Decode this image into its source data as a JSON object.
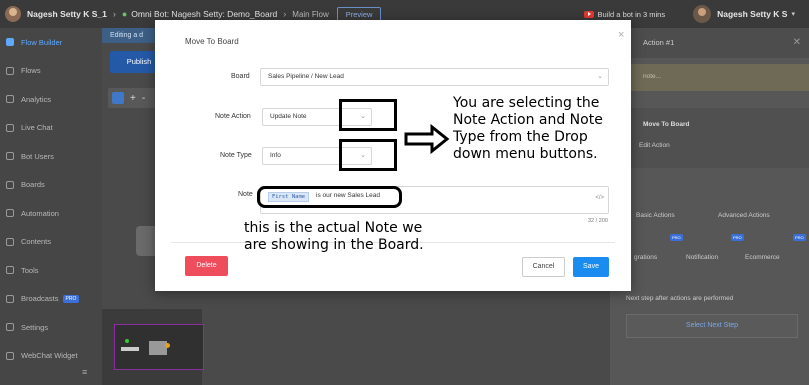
{
  "topbar": {
    "user_name": "Nagesh Setty K S_1",
    "separator": "›",
    "bot_title": "Omni Bot: Nagesh Setty: Demo_Board",
    "flow_name": "Main Flow",
    "preview_label": "Preview",
    "build_label": "Build a bot in 3 mins",
    "account_name": "Nagesh Setty K S",
    "caret": "▾"
  },
  "sidebar": {
    "items": [
      {
        "label": "Flow Builder",
        "icon": "flow-builder-icon",
        "active": true
      },
      {
        "label": "Flows",
        "icon": "flows-icon"
      },
      {
        "label": "Analytics",
        "icon": "analytics-icon"
      },
      {
        "label": "Live Chat",
        "icon": "live-chat-icon"
      },
      {
        "label": "Bot Users",
        "icon": "bot-users-icon"
      },
      {
        "label": "Boards",
        "icon": "boards-icon"
      },
      {
        "label": "Automation",
        "icon": "automation-icon"
      },
      {
        "label": "Contents",
        "icon": "contents-icon"
      },
      {
        "label": "Tools",
        "icon": "tools-icon"
      },
      {
        "label": "Broadcasts",
        "icon": "broadcasts-icon",
        "badge": "PRO"
      },
      {
        "label": "Settings",
        "icon": "settings-icon"
      },
      {
        "label": "WebChat Widget",
        "icon": "webchat-widget-icon"
      }
    ],
    "collapse_icon": "≡"
  },
  "canvas": {
    "editing_label": "Editing a d",
    "publish_label": "Publish",
    "tool_plus": "+",
    "tool_minus": "-"
  },
  "right_panel": {
    "header_title": "Action #1",
    "close": "✕",
    "note_placeholder": "note...",
    "move_label": "Move To Board",
    "edit_label": "Edit Action",
    "cells": [
      {
        "label": "Basic Actions"
      },
      {
        "label": "Advanced Actions"
      },
      {
        "label": "Integrations",
        "visible_text": "grations",
        "badge": "PRO"
      },
      {
        "label": "Notification",
        "badge": "PRO"
      },
      {
        "label": "Ecommerce",
        "badge": "PRO"
      }
    ],
    "footnote": "Next step after actions are performed",
    "next_step_label": "Select Next Step"
  },
  "modal": {
    "title": "Move To Board",
    "close": "×",
    "board_label": "Board",
    "board_value": "Sales Pipeline / New Lead",
    "note_action_label": "Note Action",
    "note_action_value": "Update Note",
    "note_type_label": "Note Type",
    "note_type_value": "Info",
    "note_label": "Note",
    "note_token": "First Name",
    "note_text": "is our new Sales Lead",
    "code_icon": "</>",
    "counter": "32 / 200",
    "delete_label": "Delete",
    "cancel_label": "Cancel",
    "save_label": "Save",
    "chevron": "⌄"
  },
  "annotations": {
    "dropdown_note": "You are selecting the Note Action and Note Type from the Drop down menu buttons.",
    "note_caption": "this is the actual Note we are showing in the Board."
  }
}
